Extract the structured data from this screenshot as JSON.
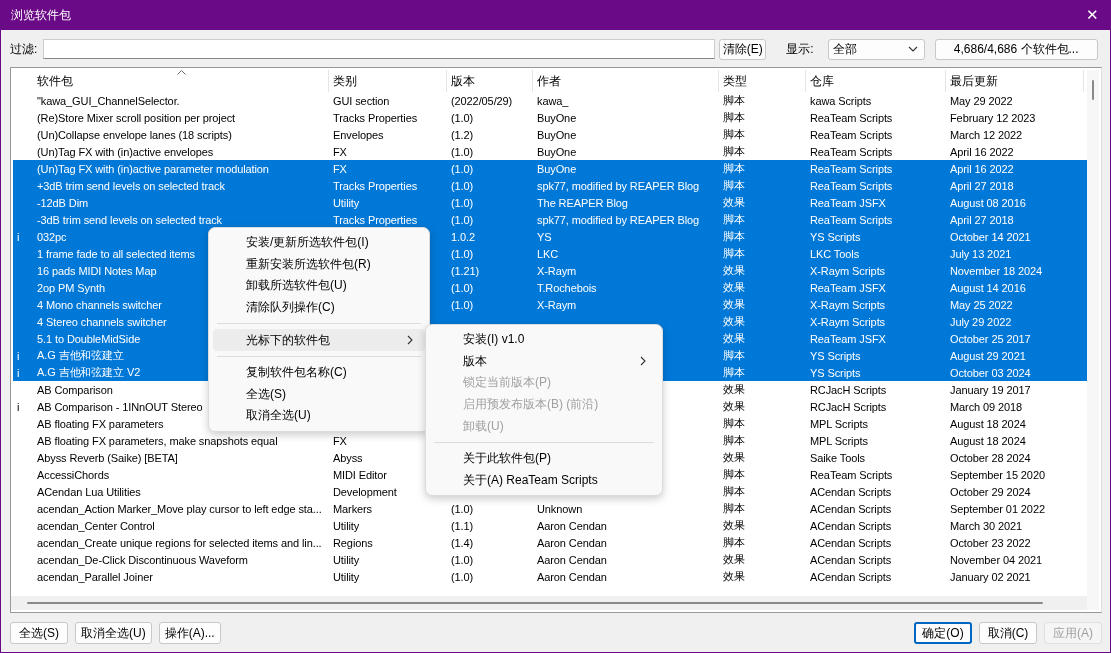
{
  "window": {
    "title": "浏览软件包",
    "close": "✕"
  },
  "filter": {
    "label": "过滤:",
    "clear_button": "清除(E)",
    "show_label": "显示:",
    "show_value": "全部",
    "count_button": "4,686/4,686 个软件包..."
  },
  "table": {
    "columns": [
      {
        "label": "软件包",
        "sorted": true
      },
      {
        "label": "类别",
        "sorted": false
      },
      {
        "label": "版本",
        "sorted": false
      },
      {
        "label": "作者",
        "sorted": false
      },
      {
        "label": "类型",
        "sorted": false
      },
      {
        "label": "仓库",
        "sorted": false
      },
      {
        "label": "最后更新",
        "sorted": false
      }
    ],
    "rows": [
      {
        "selected": false,
        "package": "\"kawa_GUI_ChannelSelector.",
        "category": "GUI section",
        "version": "(2022/05/29)",
        "author": "kawa_",
        "type": "脚本",
        "repo": "kawa Scripts",
        "updated": "May 29 2022"
      },
      {
        "selected": false,
        "package": "(Re)Store Mixer scroll position per project",
        "category": "Tracks Properties",
        "version": "(1.0)",
        "author": "BuyOne",
        "type": "脚本",
        "repo": "ReaTeam Scripts",
        "updated": "February 12 2023"
      },
      {
        "selected": false,
        "package": "(Un)Collapse envelope lanes (18 scripts)",
        "category": "Envelopes",
        "version": "(1.2)",
        "author": "BuyOne",
        "type": "脚本",
        "repo": "ReaTeam Scripts",
        "updated": "March 12 2022"
      },
      {
        "selected": false,
        "package": "(Un)Tag FX with (in)active envelopes",
        "category": "FX",
        "version": "(1.0)",
        "author": "BuyOne",
        "type": "脚本",
        "repo": "ReaTeam Scripts",
        "updated": "April 16 2022"
      },
      {
        "selected": true,
        "package": "(Un)Tag FX with (in)active parameter modulation",
        "category": "FX",
        "version": "(1.0)",
        "author": "BuyOne",
        "type": "脚本",
        "repo": "ReaTeam Scripts",
        "updated": "April 16 2022"
      },
      {
        "selected": true,
        "package": "+3dB trim send levels on selected track",
        "category": "Tracks Properties",
        "version": "(1.0)",
        "author": "spk77, modified by REAPER Blog",
        "type": "脚本",
        "repo": "ReaTeam Scripts",
        "updated": "April 27 2018"
      },
      {
        "selected": true,
        "package": "-12dB Dim",
        "category": "Utility",
        "version": "(1.0)",
        "author": "The REAPER Blog",
        "type": "效果",
        "repo": "ReaTeam JSFX",
        "updated": "August 08 2016"
      },
      {
        "selected": true,
        "package": "-3dB trim send levels on selected track",
        "category": "Tracks Properties",
        "version": "(1.0)",
        "author": "spk77, modified by REAPER Blog",
        "type": "脚本",
        "repo": "ReaTeam Scripts",
        "updated": "April 27 2018"
      },
      {
        "selected": true,
        "marker": "i",
        "package": "032pc",
        "version": "1.0.2",
        "author": "YS",
        "type": "脚本",
        "repo": "YS Scripts",
        "updated": "October 14 2021"
      },
      {
        "selected": true,
        "package": "1 frame fade to all selected items",
        "version": "(1.0)",
        "author": "LKC",
        "type": "脚本",
        "repo": "LKC Tools",
        "updated": "July 13 2021"
      },
      {
        "selected": true,
        "package": "16 pads MIDI Notes Map",
        "version": "(1.21)",
        "author": "X-Raym",
        "type": "效果",
        "repo": "X-Raym Scripts",
        "updated": "November 18 2024"
      },
      {
        "selected": true,
        "package": "2op PM Synth",
        "version": "(1.0)",
        "author": "T.Rochebois",
        "type": "效果",
        "repo": "ReaTeam JSFX",
        "updated": "August 14 2016"
      },
      {
        "selected": true,
        "package": "4 Mono channels switcher",
        "version": "(1.0)",
        "author": "X-Raym",
        "type": "效果",
        "repo": "X-Raym Scripts",
        "updated": "May 25 2022"
      },
      {
        "selected": true,
        "package": "4 Stereo channels switcher",
        "type": "效果",
        "repo": "X-Raym Scripts",
        "updated": "July 29 2022"
      },
      {
        "selected": true,
        "package": "5.1 to DoubleMidSide",
        "type": "效果",
        "repo": "ReaTeam JSFX",
        "updated": "October 25 2017"
      },
      {
        "selected": true,
        "marker": "i",
        "package": "A.G 吉他和弦建立",
        "type": "脚本",
        "repo": "YS Scripts",
        "updated": "August 29 2021"
      },
      {
        "selected": true,
        "marker": "i",
        "package": "A.G 吉他和弦建立 V2",
        "type": "脚本",
        "repo": "YS Scripts",
        "updated": "October 03 2024"
      },
      {
        "selected": false,
        "package": "AB Comparison",
        "type": "效果",
        "repo": "RCJacH Scripts",
        "updated": "January 19 2017"
      },
      {
        "selected": false,
        "marker": "i",
        "package": "AB Comparison - 1INnOUT Stereo",
        "type": "效果",
        "repo": "RCJacH Scripts",
        "updated": "March 09 2018"
      },
      {
        "selected": false,
        "package": "AB floating FX parameters",
        "type": "脚本",
        "repo": "MPL Scripts",
        "updated": "August 18 2024"
      },
      {
        "selected": false,
        "package": "AB floating FX parameters, make snapshots equal",
        "category": "FX",
        "type": "脚本",
        "repo": "MPL Scripts",
        "updated": "August 18 2024"
      },
      {
        "selected": false,
        "package": "Abyss Reverb (Saike) [BETA]",
        "category": "Abyss",
        "type": "效果",
        "repo": "Saike Tools",
        "updated": "October 28 2024"
      },
      {
        "selected": false,
        "package": "AccessiChords",
        "category": "MIDI Editor",
        "type": "脚本",
        "repo": "ReaTeam Scripts",
        "updated": "September 15 2020"
      },
      {
        "selected": false,
        "package": "ACendan Lua Utilities",
        "category": "Development",
        "type": "脚本",
        "repo": "ACendan Scripts",
        "updated": "October 29 2024"
      },
      {
        "selected": false,
        "package": "acendan_Action Marker_Move play cursor to left edge sta...",
        "category": "Markers",
        "version": "(1.0)",
        "author": "Unknown",
        "type": "脚本",
        "repo": "ACendan Scripts",
        "updated": "September 01 2022"
      },
      {
        "selected": false,
        "package": "acendan_Center Control",
        "category": "Utility",
        "version": "(1.1)",
        "author": "Aaron Cendan",
        "type": "效果",
        "repo": "ACendan Scripts",
        "updated": "March 30 2021"
      },
      {
        "selected": false,
        "package": "acendan_Create unique regions for selected items and lin...",
        "category": "Regions",
        "version": "(1.4)",
        "author": "Aaron Cendan",
        "type": "脚本",
        "repo": "ACendan Scripts",
        "updated": "October 23 2022"
      },
      {
        "selected": false,
        "package": "acendan_De-Click Discontinuous Waveform",
        "category": "Utility",
        "version": "(1.0)",
        "author": "Aaron Cendan",
        "type": "效果",
        "repo": "ACendan Scripts",
        "updated": "November 04 2021"
      },
      {
        "selected": false,
        "package": "acendan_Parallel Joiner",
        "category": "Utility",
        "version": "(1.0)",
        "author": "Aaron Cendan",
        "type": "效果",
        "repo": "ACendan Scripts",
        "updated": "January 02 2021"
      }
    ]
  },
  "context_menu": {
    "groups": [
      [
        {
          "label": "安装/更新所选软件包(I)",
          "disabled": false,
          "selected": false,
          "submenu": false
        },
        {
          "label": "重新安装所选软件包(R)",
          "disabled": false,
          "selected": false,
          "submenu": false
        },
        {
          "label": "卸载所选软件包(U)",
          "disabled": false,
          "selected": false,
          "submenu": false
        },
        {
          "label": "清除队列操作(C)",
          "disabled": false,
          "selected": false,
          "submenu": false
        }
      ],
      [
        {
          "label": "光标下的软件包",
          "disabled": false,
          "selected": true,
          "submenu": true
        }
      ],
      [
        {
          "label": "复制软件包名称(C)",
          "disabled": false,
          "selected": false,
          "submenu": false
        },
        {
          "label": "全选(S)",
          "disabled": false,
          "selected": false,
          "submenu": false
        },
        {
          "label": "取消全选(U)",
          "disabled": false,
          "selected": false,
          "submenu": false
        }
      ]
    ]
  },
  "submenu": {
    "groups": [
      [
        {
          "label": "安装(I) v1.0",
          "disabled": false,
          "selected": false,
          "submenu": false
        },
        {
          "label": "版本",
          "disabled": false,
          "selected": false,
          "submenu": true
        },
        {
          "label": "锁定当前版本(P)",
          "disabled": true,
          "selected": false,
          "submenu": false
        },
        {
          "label": "启用预发布版本(B) (前沿)",
          "disabled": true,
          "selected": false,
          "submenu": false
        },
        {
          "label": "卸载(U)",
          "disabled": true,
          "selected": false,
          "submenu": false
        }
      ],
      [
        {
          "label": "关于此软件包(P)",
          "disabled": false,
          "selected": false,
          "submenu": false
        },
        {
          "label": "关于(A) ReaTeam Scripts",
          "disabled": false,
          "selected": false,
          "submenu": false
        }
      ]
    ]
  },
  "buttons_left": [
    {
      "label": "全选(S)",
      "disabled": false,
      "focused": false
    },
    {
      "label": "取消全选(U)",
      "disabled": false,
      "focused": false
    },
    {
      "label": "操作(A)...",
      "disabled": false,
      "focused": false
    }
  ],
  "buttons_right": [
    {
      "label": "确定(O)",
      "disabled": false,
      "focused": true
    },
    {
      "label": "取消(C)",
      "disabled": false,
      "focused": false
    },
    {
      "label": "应用(A)",
      "disabled": true,
      "focused": false
    }
  ]
}
